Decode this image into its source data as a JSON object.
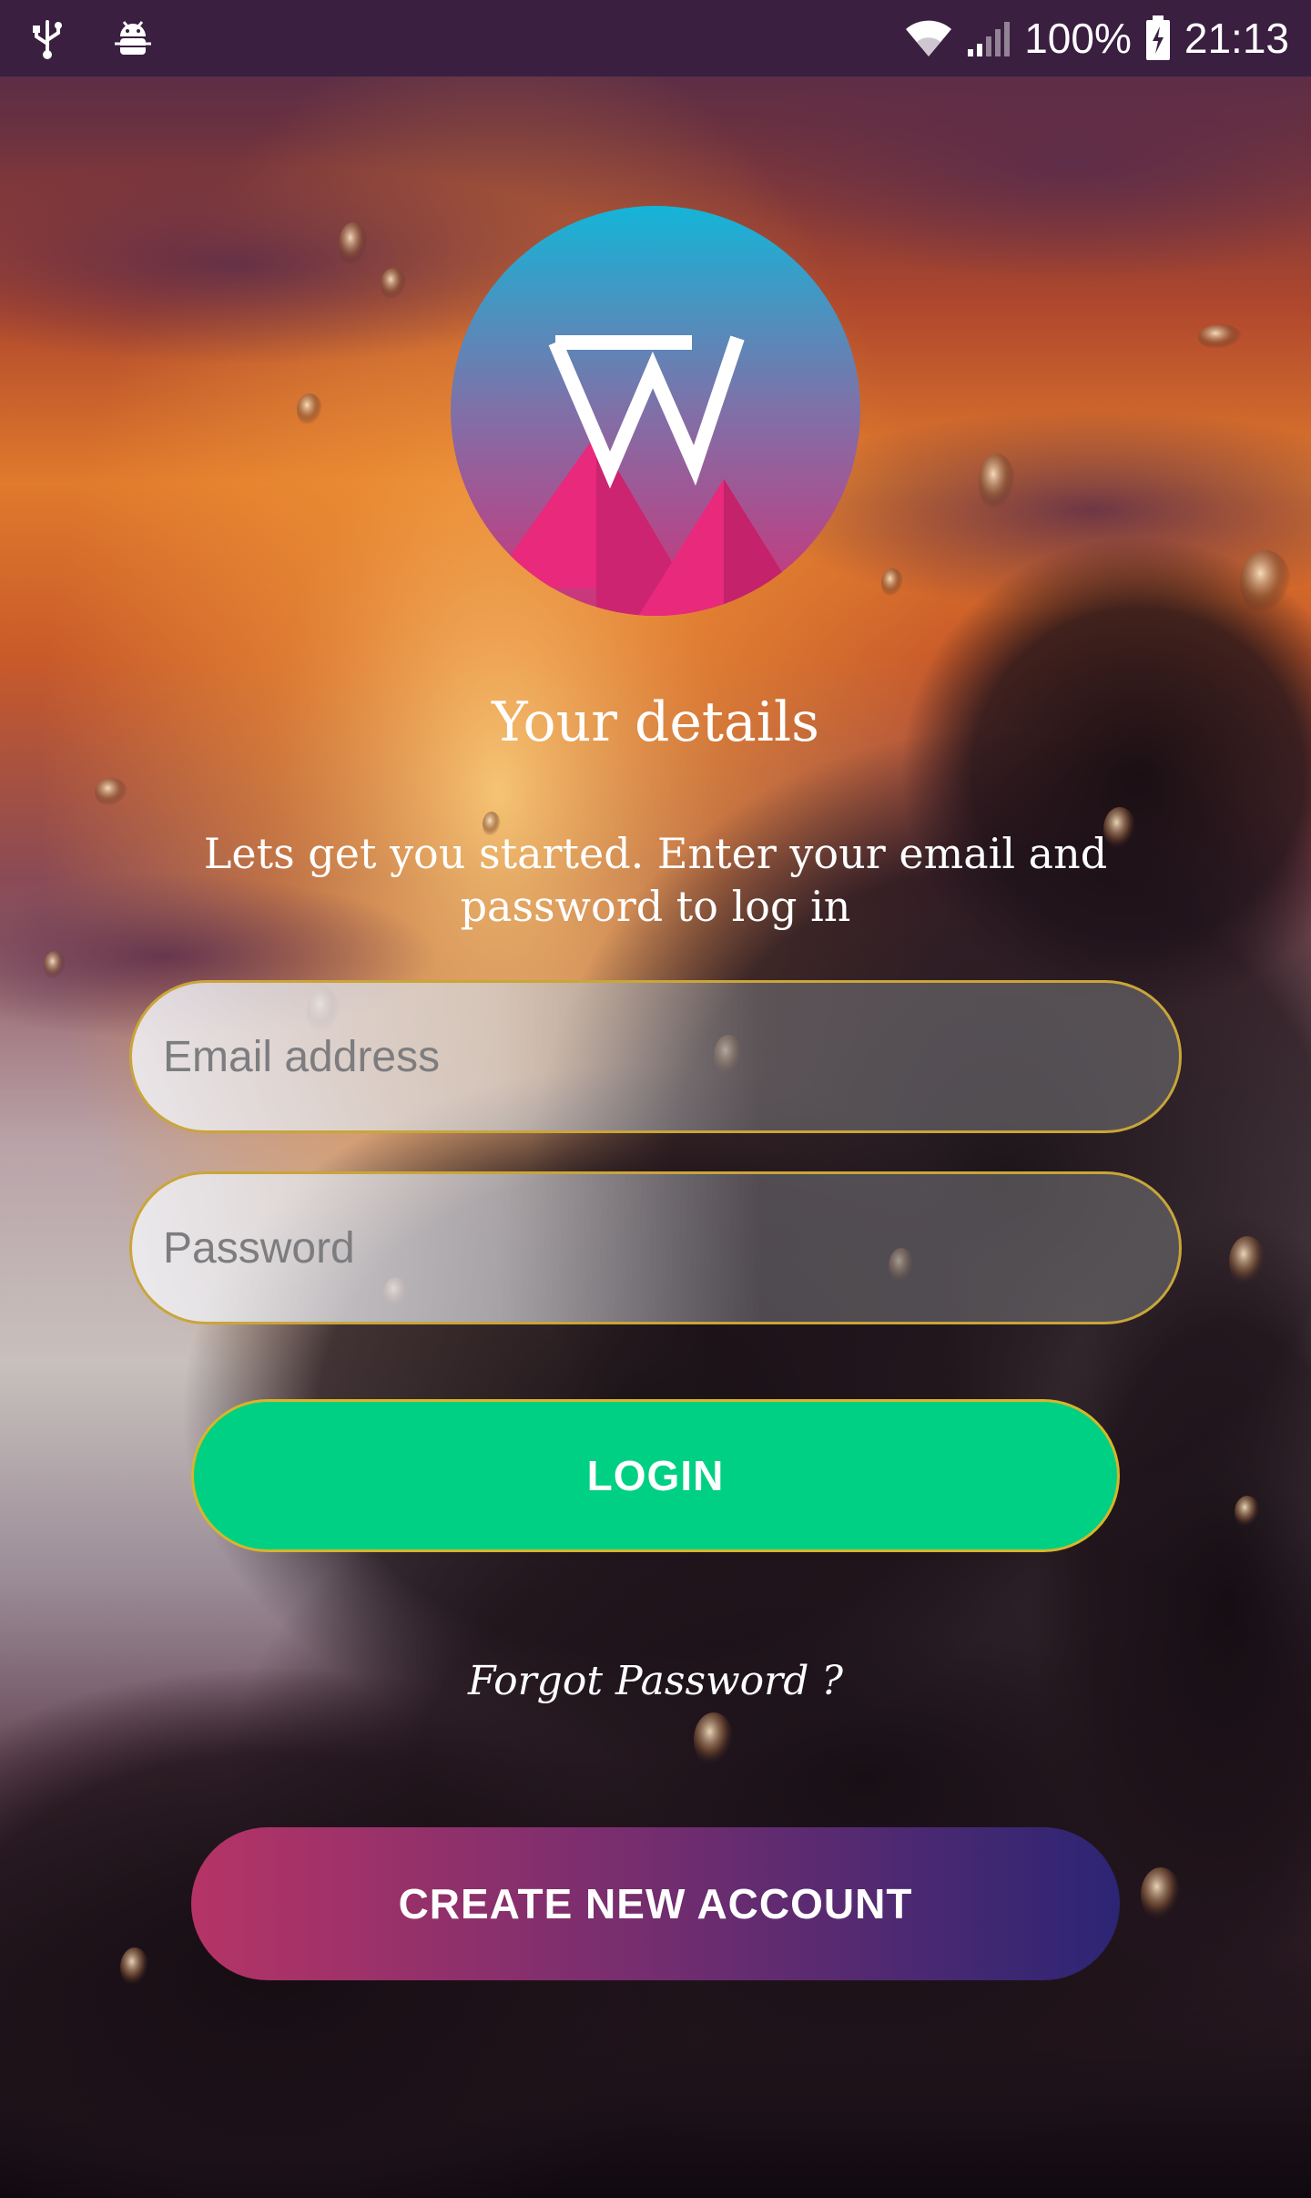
{
  "status_bar": {
    "battery_percent": "100%",
    "time": "21:13",
    "icons": [
      "usb-icon",
      "android-debug-icon",
      "wifi-icon",
      "signal-icon",
      "battery-charging-icon"
    ]
  },
  "logo": {
    "icon": "app-logo-icon",
    "colors": {
      "top": "#1ab4d6",
      "bottom": "#c9387f",
      "mountains": "#e52b7c"
    }
  },
  "header": {
    "title": "Your details",
    "subtitle": "Lets get you started. Enter your email and password to log in"
  },
  "form": {
    "email_placeholder": "Email address",
    "email_value": "",
    "password_placeholder": "Password",
    "password_value": "",
    "login_label": "LOGIN",
    "forgot_label": "Forgot Password ?",
    "create_label": "CREATE NEW ACCOUNT"
  },
  "colors": {
    "login_button": "#00d083",
    "input_border": "#c9a53a",
    "create_gradient_start": "#b53466",
    "create_gradient_end": "#2c2574"
  }
}
